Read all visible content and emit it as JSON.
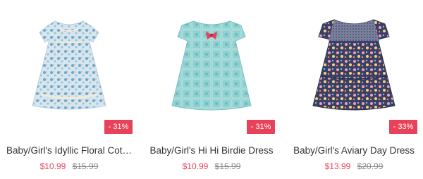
{
  "products": [
    {
      "title": "Baby/Girl's Idyllic Floral Cot…",
      "discount": "- 31%",
      "sale_price": "$10.99",
      "original_price": "$15.99",
      "image_icon": "floral-dress-image"
    },
    {
      "title": "Baby/Girl's Hi Hi Birdie Dress",
      "discount": "- 31%",
      "sale_price": "$10.99",
      "original_price": "$15.99",
      "image_icon": "birdie-dress-image"
    },
    {
      "title": "Baby/Girl's Aviary Day Dress",
      "discount": "- 33%",
      "sale_price": "$13.99",
      "original_price": "$20.99",
      "image_icon": "aviary-dress-image"
    }
  ],
  "colors": {
    "sale": "#e8425a",
    "badge_bg": "#e8425a",
    "title_text": "#333333",
    "strike_text": "#888888"
  }
}
